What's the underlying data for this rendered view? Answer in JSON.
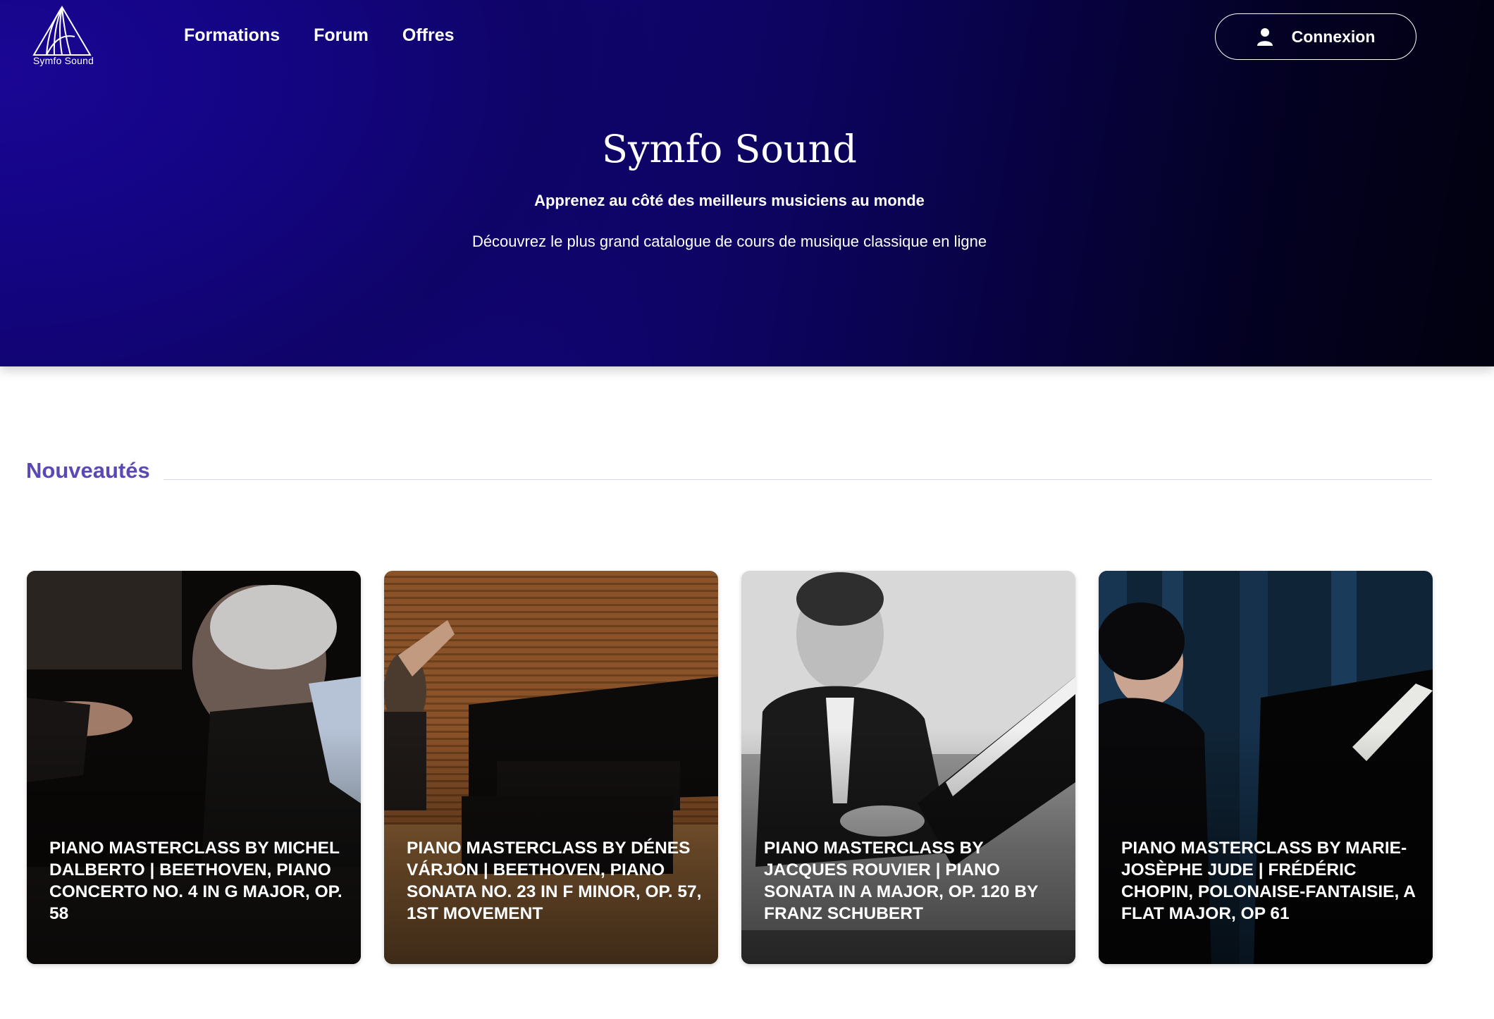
{
  "brand": {
    "name": "Symfo Sound",
    "logo_icon": "symfo-sound-logo-icon"
  },
  "nav": {
    "items": [
      "Formations",
      "Forum",
      "Offres"
    ]
  },
  "login": {
    "label": "Connexion",
    "icon": "user-icon"
  },
  "hero": {
    "title": "Symfo Sound",
    "subtitle": "Apprenez au côté des meilleurs musiciens au monde",
    "tagline": "Découvrez le plus grand catalogue de cours de musique classique en ligne"
  },
  "section": {
    "title": "Nouveautés"
  },
  "cards": [
    {
      "title": "PIANO MASTERCLASS BY MICHEL DALBERTO | BEETHOVEN, PIANO CONCERTO NO. 4 IN G MAJOR, OP. 58"
    },
    {
      "title": "PIANO MASTERCLASS BY DÉNES VÁRJON | BEETHOVEN, PIANO SONATA NO. 23 IN F MINOR, OP. 57, 1ST MOVEMENT"
    },
    {
      "title": "PIANO MASTERCLASS BY JACQUES ROUVIER | PIANO SONATA IN A MAJOR, OP. 120 BY FRANZ SCHUBERT"
    },
    {
      "title": "PIANO MASTERCLASS BY MARIE-JOSÈPHE JUDE | FRÉDÉRIC CHOPIN, POLONAISE-FANTAISIE, A FLAT MAJOR, OP 61"
    }
  ],
  "colors": {
    "hero_start": "#17058c",
    "hero_end": "#02010f",
    "section_title": "#5a48b5"
  }
}
